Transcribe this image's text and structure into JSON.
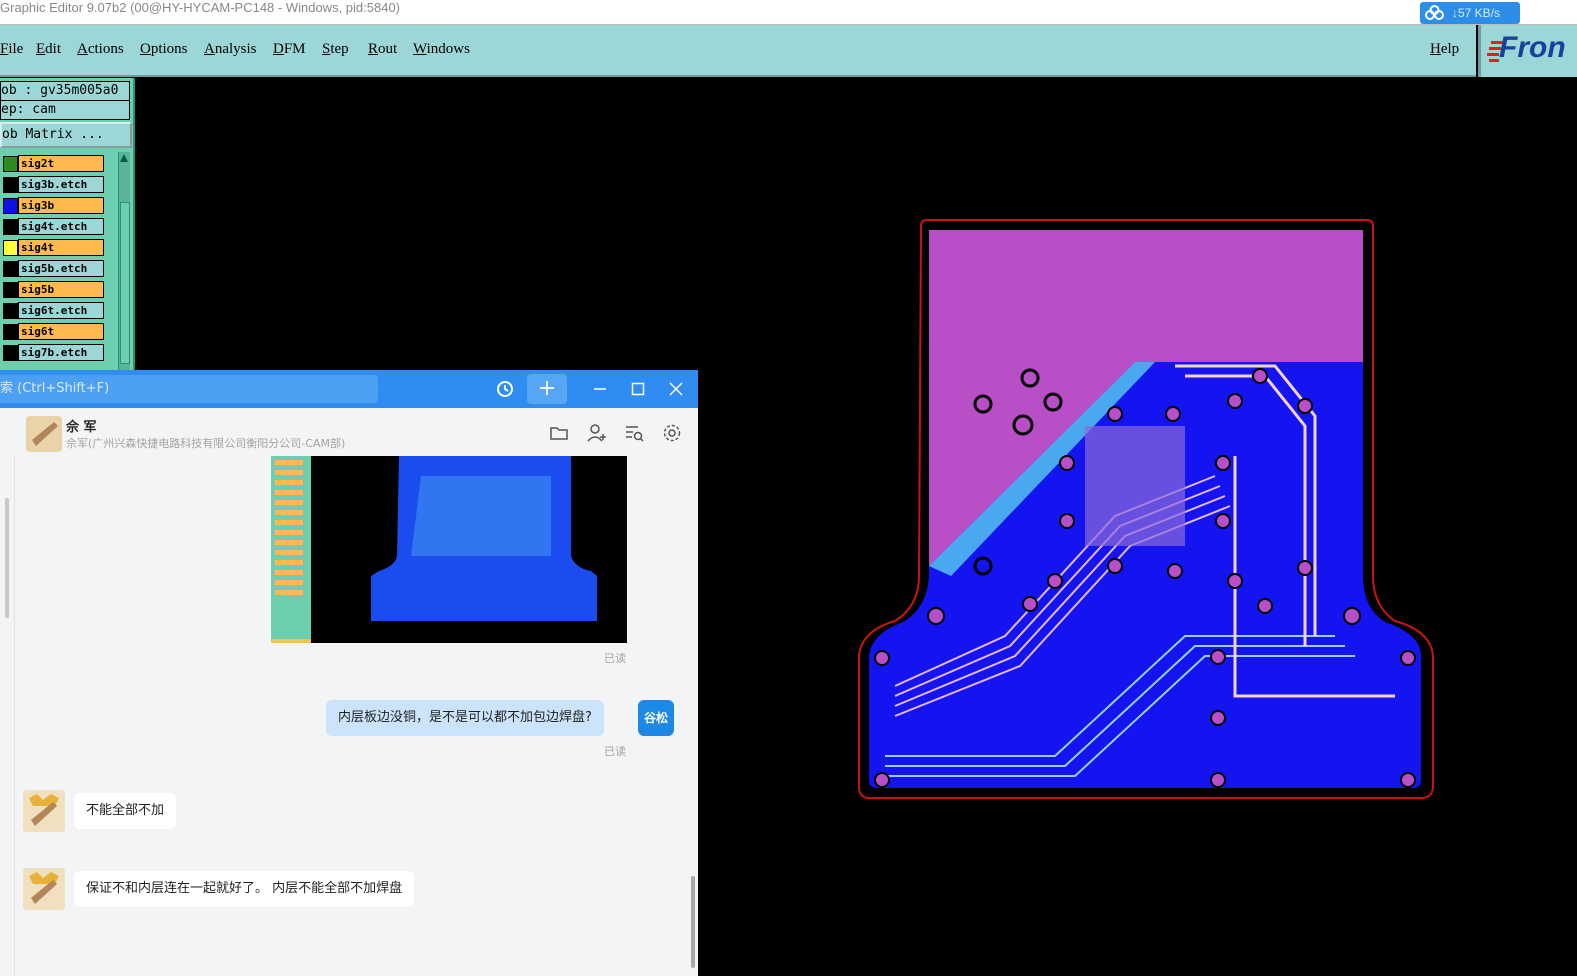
{
  "window": {
    "title": "Graphic Editor 9.07b2 (00@HY-HYCAM-PC148 - Windows, pid:5840)",
    "speed": "57 KB/s"
  },
  "menu": {
    "items": [
      "File",
      "Edit",
      "Actions",
      "Options",
      "Analysis",
      "DFM",
      "Step",
      "Rout",
      "Windows"
    ],
    "help": "Help",
    "logo": "Fron"
  },
  "panel": {
    "job": "ob : gv35m005a0",
    "step": "ep: cam",
    "matrix_button": "ob Matrix ..."
  },
  "layers": [
    {
      "name": "sig2t",
      "swatch": "#2e8b22",
      "bg": "#ffb94d"
    },
    {
      "name": "sig3b.etch",
      "swatch": "#000000",
      "bg": "#9cd6d6"
    },
    {
      "name": "sig3b",
      "swatch": "#1010e0",
      "bg": "#ffb94d"
    },
    {
      "name": "sig4t.etch",
      "swatch": "#000000",
      "bg": "#9cd6d6"
    },
    {
      "name": "sig4t",
      "swatch": "#ffff40",
      "bg": "#ffb94d"
    },
    {
      "name": "sig5b.etch",
      "swatch": "#000000",
      "bg": "#9cd6d6"
    },
    {
      "name": "sig5b",
      "swatch": "#000000",
      "bg": "#ffb94d"
    },
    {
      "name": "sig6t.etch",
      "swatch": "#000000",
      "bg": "#9cd6d6"
    },
    {
      "name": "sig6t",
      "swatch": "#000000",
      "bg": "#ffb94d"
    },
    {
      "name": "sig7b.etch",
      "swatch": "#000000",
      "bg": "#9cd6d6"
    }
  ],
  "chat": {
    "search_placeholder": "索 (Ctrl+Shift+F)",
    "contact_name": "佘 军",
    "contact_org": "佘军(广州兴森快捷电路科技有限公司衡阳分公司-CAM部)",
    "read_1": "已读",
    "my_message": "内层板边没铜，是不是可以都不加包边焊盘?",
    "my_avatar_name": "谷松",
    "read_2": "已读",
    "reply_1": "不能全部不加",
    "reply_2": "保证不和内层连在一起就好了。 内层不能全部不加焊盘"
  },
  "colors": {
    "menu_bg": "#9cd6d6",
    "panel_bg": "#6bcfb0",
    "chat_accent": "#2f8cf0",
    "pcb_magenta": "#b84fc6",
    "pcb_blue": "#1414f0",
    "pcb_lightblue": "#4aa8f0",
    "pcb_outline": "#d81818"
  }
}
